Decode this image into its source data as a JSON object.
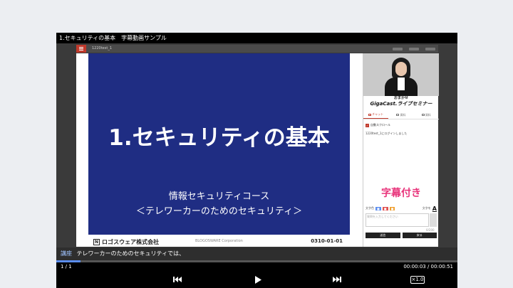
{
  "player": {
    "title": "1.セキュリティの基本　字幕動画サンプル"
  },
  "app": {
    "session_id": "1220test_1"
  },
  "slide": {
    "title": "1.セキュリティの基本",
    "subtitle_line1": "情報セキュリティコース",
    "subtitle_line2": "＜テレワーカーのためのセキュリティ＞",
    "company": "ロゴスウェア株式会社",
    "company_en": "BLOGOSWARE Corporation",
    "code": "0310-01-01",
    "background_color": "#1f2d83"
  },
  "sidepanel": {
    "brand_small": "おまかせ",
    "brand_main": "GigaCast.ライブセミナー",
    "tabs": [
      {
        "label": "チャット",
        "active": true
      },
      {
        "label": "資料",
        "active": false
      },
      {
        "label": "資料",
        "active": false
      }
    ],
    "auto_scroll_label": "自動スクロール",
    "message": "1220test_1にログインしました",
    "caption_badge": "字幕付き",
    "badge_color": "#e8337a",
    "color_label": "文字色",
    "color_buttons": [
      {
        "label": "■",
        "color": "#5b8def"
      },
      {
        "label": "■",
        "color": "#e05050"
      },
      {
        "label": "■",
        "color": "#f0a030"
      }
    ],
    "font_size_label": "文字を",
    "font_icon": "A",
    "comment_placeholder": "質問を入力してください",
    "counter": "0/200",
    "send_buttons": [
      "送信",
      "戻る"
    ]
  },
  "caption": {
    "speaker": "講座",
    "text": "テレワーカーのためのセキュリティでは、"
  },
  "status": {
    "page": "1 / 1",
    "time": "00:00:03 / 00:00:51",
    "progress": 0.06
  },
  "controls": {
    "speed": "×1.0",
    "icons": [
      "skip-previous-icon",
      "play-icon",
      "skip-next-icon"
    ]
  }
}
